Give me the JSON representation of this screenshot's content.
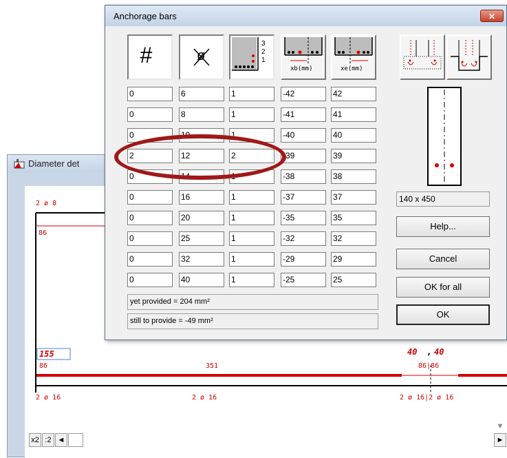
{
  "background_window": {
    "title": "Diameter det",
    "top_label": "2 ø 8",
    "top_left_number": "86",
    "box_number": "155",
    "left_number": "86",
    "middle_number": "351",
    "right_top_left": "40",
    "right_top_sep": ",",
    "right_top_right": "40",
    "right_mid": "86|86",
    "bottom_left": "2 ø 16",
    "bottom_middle": "2 ø 16",
    "bottom_right": "2 ø 16|2 ø 16",
    "zoom_x2": "x2",
    "zoom_div2": ":2",
    "arrow_left": "◄",
    "arrow_right": "►",
    "arrow_down": "▼"
  },
  "dialog": {
    "title": "Anchorage bars",
    "close_label": "✕",
    "headers": {
      "count": "#",
      "diameter": "ø",
      "layer_digits": [
        "3",
        "2",
        "1"
      ],
      "xb": "xb(mm)",
      "xe": "xe(mm)"
    },
    "rows": [
      {
        "count": "0",
        "diameter": "6",
        "layer": "1",
        "xb": "-42",
        "xe": "42"
      },
      {
        "count": "0",
        "diameter": "8",
        "layer": "1",
        "xb": "-41",
        "xe": "41"
      },
      {
        "count": "0",
        "diameter": "10",
        "layer": "1",
        "xb": "-40",
        "xe": "40"
      },
      {
        "count": "2",
        "diameter": "12",
        "layer": "2",
        "xb": "-39",
        "xe": "39"
      },
      {
        "count": "0",
        "diameter": "14",
        "layer": "1",
        "xb": "-38",
        "xe": "38"
      },
      {
        "count": "0",
        "diameter": "16",
        "layer": "1",
        "xb": "-37",
        "xe": "37"
      },
      {
        "count": "0",
        "diameter": "20",
        "layer": "1",
        "xb": "-35",
        "xe": "35"
      },
      {
        "count": "0",
        "diameter": "25",
        "layer": "1",
        "xb": "-32",
        "xe": "32"
      },
      {
        "count": "0",
        "diameter": "32",
        "layer": "1",
        "xb": "-29",
        "xe": "29"
      },
      {
        "count": "0",
        "diameter": "40",
        "layer": "1",
        "xb": "-25",
        "xe": "25"
      }
    ],
    "status_provided": "yet provided = 204 mm²",
    "status_to_provide": "still to provide = -49 mm²",
    "section_size": "140 x 450",
    "buttons": {
      "help": "Help...",
      "cancel": "Cancel",
      "ok_all": "OK for all",
      "ok": "OK"
    }
  },
  "colors": {
    "annotation_red": "#d40000",
    "highlight": "#a01818"
  }
}
